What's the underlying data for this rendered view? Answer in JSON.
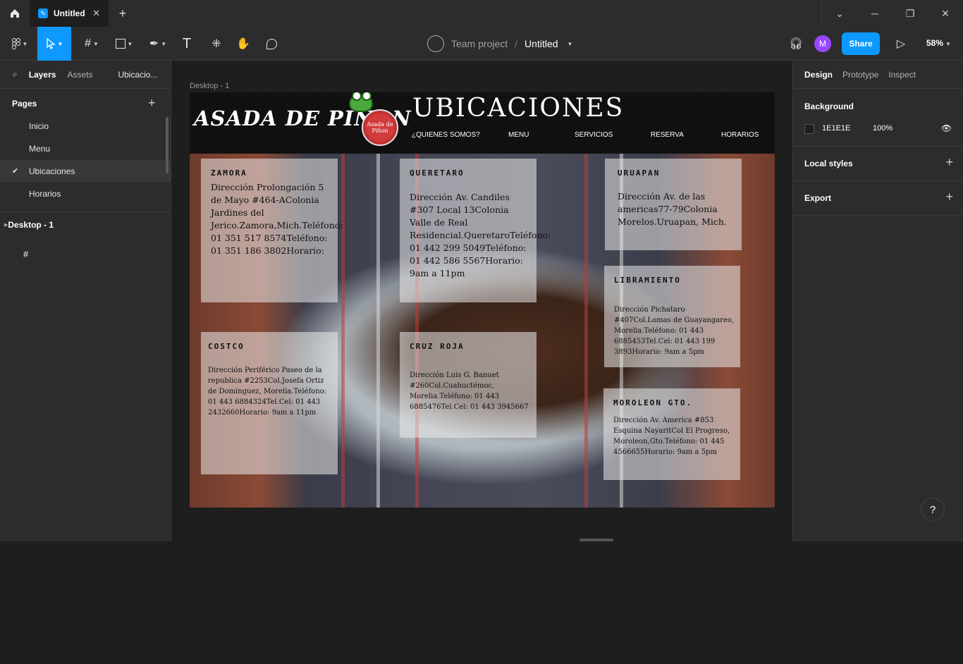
{
  "titlebar": {
    "tab_title": "Untitled",
    "close_glyph": "✕",
    "newtab_glyph": "+",
    "minimize_glyph": "─",
    "restore_glyph": "❐",
    "winclose_glyph": "✕",
    "dropdown_glyph": "⌄"
  },
  "toolbar": {
    "team": "Team project",
    "separator": "/",
    "file_name": "Untitled",
    "share_label": "Share",
    "avatar_initial": "M",
    "zoom": "58%"
  },
  "left_panel": {
    "tabs": {
      "layers": "Layers",
      "assets": "Assets",
      "page_selector": "Ubicacio..."
    },
    "pages_title": "Pages",
    "pages": [
      "Inicio",
      "Menu",
      "Ubicaciones",
      "Horarios"
    ],
    "layer": "Desktop - 1"
  },
  "right_panel": {
    "tabs": {
      "design": "Design",
      "prototype": "Prototype",
      "inspect": "Inspect"
    },
    "background_title": "Background",
    "background_hex": "1E1E1E",
    "background_opacity": "100%",
    "local_styles": "Local styles",
    "export": "Export"
  },
  "canvas": {
    "frame_label": "Desktop - 1",
    "site": {
      "logo": "ASADA DE PIÑON",
      "badge": "Asada de Piñon",
      "title": "UBICACIONES",
      "nav": [
        "¿QUIENES SOMOS?",
        "MENU",
        "SERVICIOS",
        "RESERVA",
        "HORARIOS"
      ],
      "cards": {
        "zamora": {
          "title": "ZAMORA",
          "body": "Dirección Prolongación 5 de Mayo #464-AColonia Jardines del Jerico.Zamora,Mich.Teléfono: 01 351 517 8574Teléfono: 01 351 186 3802Horario:"
        },
        "queretaro": {
          "title": "QUERETARO",
          "body": "Dirección Av. Candiles #307 Local 13Colonia Valle de Real Residencial.QueretaroTeléfono: 01 442 299 5049Teléfono: 01 442 586 5567Horario: 9am a 11pm"
        },
        "uruapan": {
          "title": "URUAPAN",
          "body": "Dirección Av. de las americas77-79Colonia Morelos.Uruapan, Mich."
        },
        "libramiento": {
          "title": "LIBRAMIENTO",
          "body": "Dirección Pichataro #407Col.Lomas de Guayangareo, Morelia.Teléfono: 01 443 6885453Tel.Cel: 01 443 199 3893Horario: 9am a 5pm"
        },
        "costco": {
          "title": "COSTCO",
          "body": "Dirección Periférico Paseo de la republica #2253Col.Josefa Ortiz de Dominguez, Morelia.Teléfono: 01 443 6884324Tel.Cel: 01 443 2432660Horario: 9am a 11pm"
        },
        "cruzroja": {
          "title": "CRUZ ROJA",
          "body": "Dirección Luis G. Banuet #260Col.Cuahuctémoc, Morelia.Teléfono: 01 443 6885476Tel.Cel: 01 443 3945667"
        },
        "moroleon": {
          "title": "MOROLEON GTO.",
          "body": "Dirección Av. America #853 Esquina NayaritCol El Progreso, Moroleon,Gto.Teléfono: 01 445 4566655Horario: 9am a 5pm"
        }
      }
    }
  },
  "help_label": "?"
}
